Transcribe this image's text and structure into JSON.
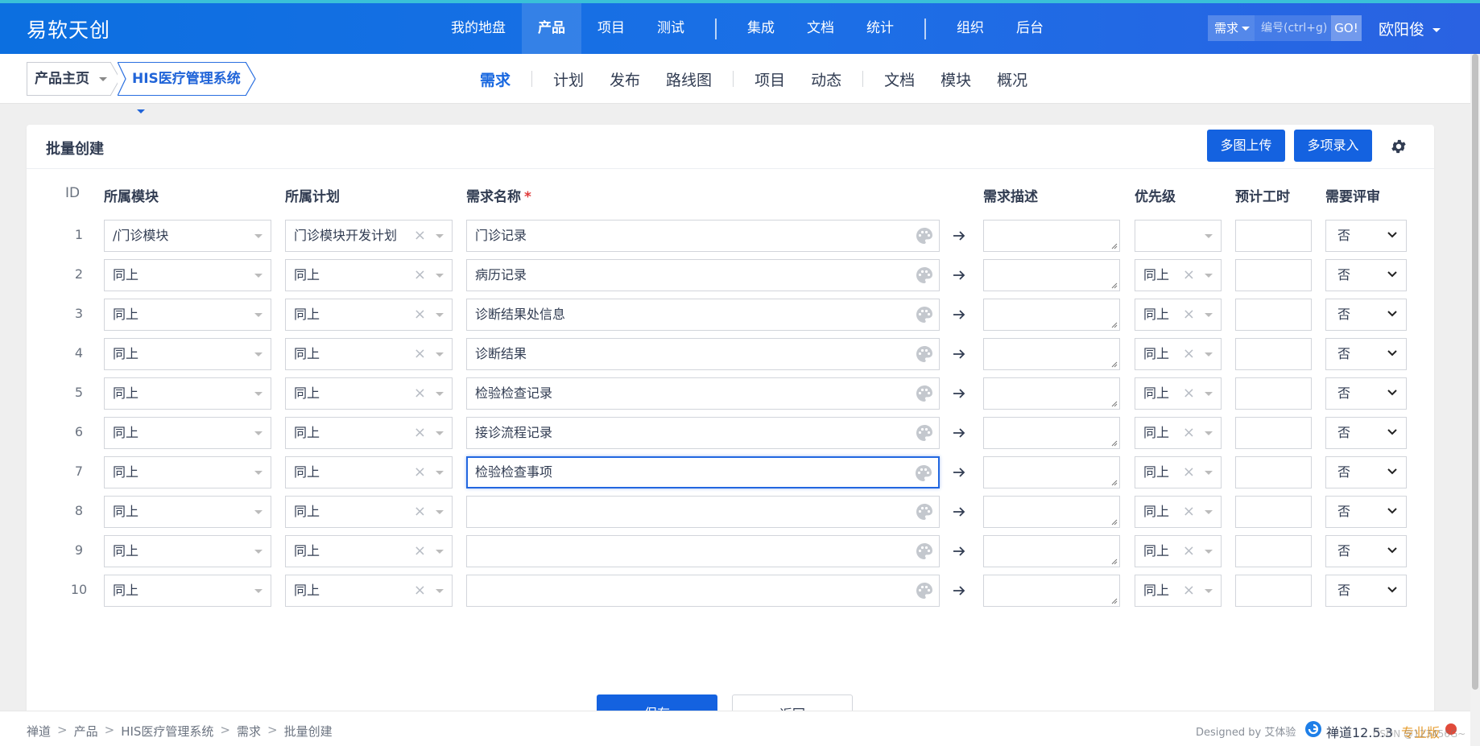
{
  "app": {
    "brand": "易软天创"
  },
  "topnav": {
    "items": [
      "我的地盘",
      "产品",
      "项目",
      "测试",
      "集成",
      "文档",
      "统计",
      "组织",
      "后台"
    ],
    "active": "产品"
  },
  "search": {
    "type": "需求",
    "placeholder": "编号(ctrl+g)",
    "go": "GO!"
  },
  "user": {
    "name": "欧阳俊"
  },
  "breadcrumb": {
    "home": "产品主页",
    "product": "HIS医疗管理系统"
  },
  "subtabs": [
    "需求",
    "计划",
    "发布",
    "路线图",
    "项目",
    "动态",
    "文档",
    "模块",
    "概况"
  ],
  "subtab_active": "需求",
  "panel": {
    "title": "批量创建",
    "upload_label": "多图上传",
    "multi_label": "多项录入"
  },
  "columns": {
    "id": "ID",
    "module": "所属模块",
    "plan": "所属计划",
    "name": "需求名称",
    "name_required": "*",
    "desc": "需求描述",
    "priority": "优先级",
    "hours": "预计工时",
    "review": "需要评审"
  },
  "rows": [
    {
      "id": "1",
      "module": "/门诊模块",
      "plan": "门诊模块开发计划",
      "name": "门诊记录",
      "priority": "",
      "review": "否"
    },
    {
      "id": "2",
      "module": "同上",
      "plan": "同上",
      "name": "病历记录",
      "priority": "同上",
      "review": "否"
    },
    {
      "id": "3",
      "module": "同上",
      "plan": "同上",
      "name": "诊断结果处信息",
      "priority": "同上",
      "review": "否"
    },
    {
      "id": "4",
      "module": "同上",
      "plan": "同上",
      "name": "诊断结果",
      "priority": "同上",
      "review": "否"
    },
    {
      "id": "5",
      "module": "同上",
      "plan": "同上",
      "name": "检验检查记录",
      "priority": "同上",
      "review": "否"
    },
    {
      "id": "6",
      "module": "同上",
      "plan": "同上",
      "name": "接诊流程记录",
      "priority": "同上",
      "review": "否"
    },
    {
      "id": "7",
      "module": "同上",
      "plan": "同上",
      "name": "检验检查事项",
      "priority": "同上",
      "review": "否"
    },
    {
      "id": "8",
      "module": "同上",
      "plan": "同上",
      "name": "",
      "priority": "同上",
      "review": "否"
    },
    {
      "id": "9",
      "module": "同上",
      "plan": "同上",
      "name": "",
      "priority": "同上",
      "review": "否"
    },
    {
      "id": "10",
      "module": "同上",
      "plan": "同上",
      "name": "",
      "priority": "同上",
      "review": "否"
    }
  ],
  "focused_row": "7",
  "actions": {
    "save": "保存",
    "back": "返回"
  },
  "footer": {
    "crumbs": [
      "禅道",
      "产品",
      "HIS医疗管理系统",
      "需求",
      "批量创建"
    ],
    "designed_by": "Designed by 艾体验",
    "version": "禅道12.5.3",
    "edition": "专业版"
  },
  "watermark": "CSDN @123456G~",
  "colors": {
    "brand_blue": "#1462e0",
    "header_gradient_start": "#0c6fe0",
    "active_tab": "#1968e0",
    "required": "#e03a3a",
    "pro_edition": "#e69b2c"
  }
}
